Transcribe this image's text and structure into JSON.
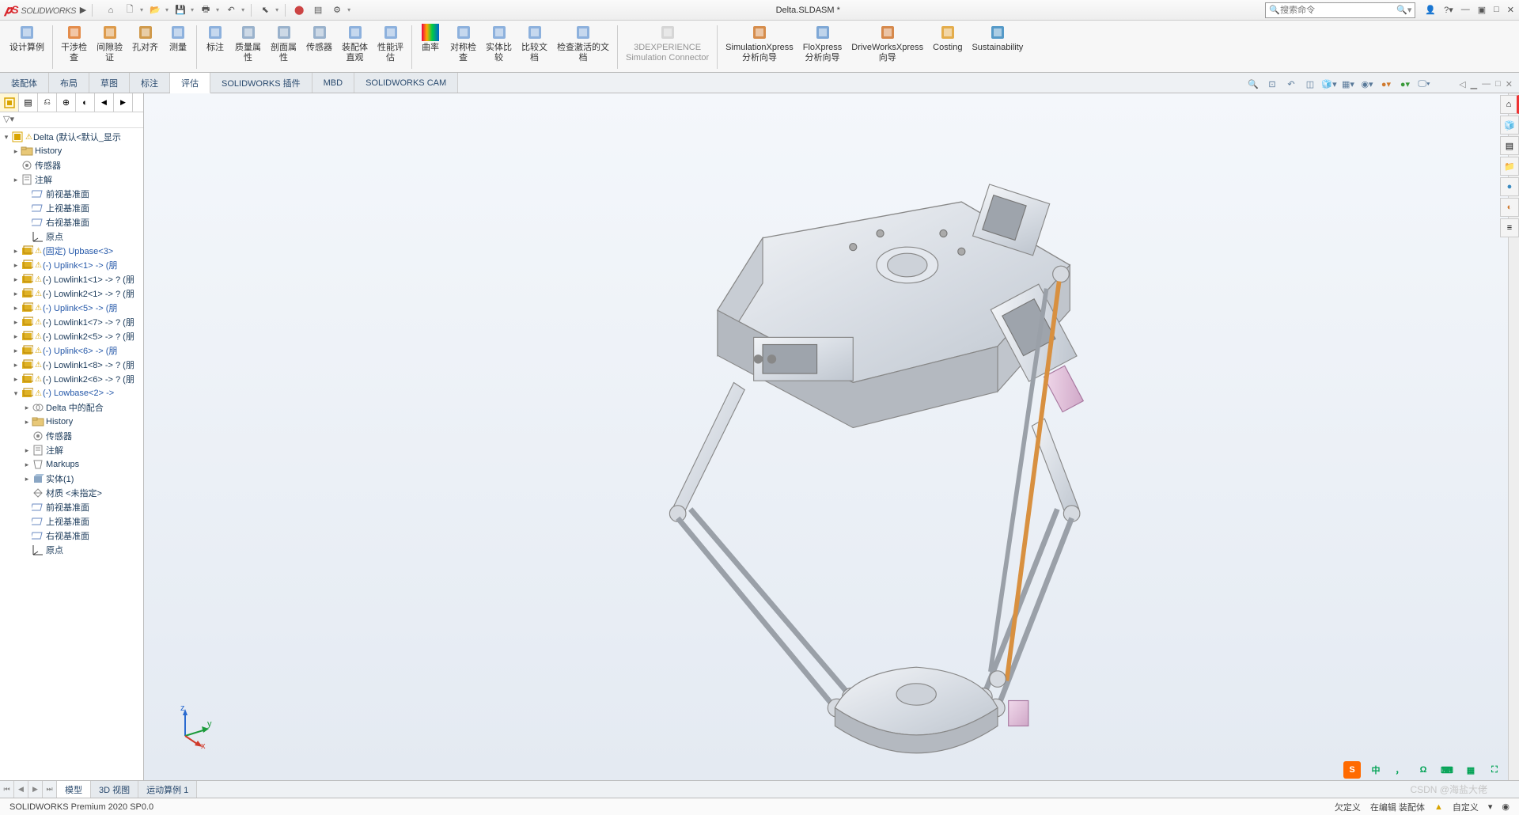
{
  "title": {
    "app": "SOLIDWORKS",
    "document": "Delta.SLDASM *"
  },
  "search": {
    "placeholder": "搜索命令"
  },
  "ribbon": [
    {
      "id": "design-study",
      "label": "设计算例",
      "color": "#7aa4d8"
    },
    {
      "id": "interference",
      "label": "干涉检\n查",
      "color": "#e07a2e"
    },
    {
      "id": "clearance",
      "label": "间隙验\n证",
      "color": "#d88b2e"
    },
    {
      "id": "hole-align",
      "label": "孔对齐",
      "color": "#c98a2e"
    },
    {
      "id": "measure",
      "label": "测量",
      "color": "#7aa4d8"
    },
    {
      "id": "markup",
      "label": "标注",
      "color": "#7aa4d8"
    },
    {
      "id": "mass-props",
      "label": "质量属\n性",
      "color": "#8aa6c4"
    },
    {
      "id": "section-props",
      "label": "剖面属\n性",
      "color": "#8aa6c4"
    },
    {
      "id": "sensor",
      "label": "传感器",
      "color": "#8aa6c4"
    },
    {
      "id": "assembly-vis",
      "label": "装配体\n直观",
      "color": "#7aa4d8"
    },
    {
      "id": "perf-eval",
      "label": "性能评\n估",
      "color": "#7aa4d8"
    },
    {
      "id": "curvature",
      "label": "曲率",
      "color": "#e06a2e",
      "rainbow": true
    },
    {
      "id": "symmetry",
      "label": "对称检\n查",
      "color": "#7aa4d8"
    },
    {
      "id": "compare-bodies",
      "label": "实体比\n较",
      "color": "#7aa4d8"
    },
    {
      "id": "compare-docs",
      "label": "比较文\n档",
      "color": "#7aa4d8"
    },
    {
      "id": "check-active",
      "label": "检查激活的文\n档",
      "color": "#7aa4d8"
    },
    {
      "id": "3dexp",
      "label": "3DEXPERIENCE\nSimulation Connector",
      "disabled": true,
      "color": "#aaa"
    },
    {
      "id": "simx",
      "label": "SimulationXpress\n分析向导",
      "color": "#d07a2e"
    },
    {
      "id": "flox",
      "label": "FloXpress\n分析向导",
      "color": "#6a9ad0"
    },
    {
      "id": "dwx",
      "label": "DriveWorksXpress\n向导",
      "color": "#d0762e"
    },
    {
      "id": "costing",
      "label": "Costing",
      "color": "#e0a02e"
    },
    {
      "id": "sustain",
      "label": "Sustainability",
      "color": "#3a8ac0"
    }
  ],
  "ribbonSeparators": [
    1,
    5,
    11,
    16,
    17
  ],
  "cmdtabs": [
    {
      "id": "assembly",
      "label": "装配体"
    },
    {
      "id": "layout",
      "label": "布局"
    },
    {
      "id": "sketch",
      "label": "草图"
    },
    {
      "id": "annotate",
      "label": "标注"
    },
    {
      "id": "evaluate",
      "label": "评估",
      "active": true
    },
    {
      "id": "addins",
      "label": "SOLIDWORKS 插件"
    },
    {
      "id": "mbd",
      "label": "MBD"
    },
    {
      "id": "cam",
      "label": "SOLIDWORKS CAM"
    }
  ],
  "tree": {
    "root": "Delta  (默认<默认_显示",
    "items": [
      {
        "lvl": 1,
        "exp": "▸",
        "ico": "folder",
        "label": "History"
      },
      {
        "lvl": 1,
        "ico": "sensor",
        "label": "传感器"
      },
      {
        "lvl": 1,
        "exp": "▸",
        "ico": "note",
        "label": "注解"
      },
      {
        "lvl": 2,
        "ico": "plane",
        "label": "前视基准面"
      },
      {
        "lvl": 2,
        "ico": "plane",
        "label": "上视基准面"
      },
      {
        "lvl": 2,
        "ico": "plane",
        "label": "右视基准面"
      },
      {
        "lvl": 2,
        "ico": "origin",
        "label": "原点"
      },
      {
        "lvl": 1,
        "exp": "▸",
        "warn": true,
        "ico": "part",
        "label": "(固定) Upbase<3>",
        "blue": true
      },
      {
        "lvl": 1,
        "exp": "▸",
        "warn": true,
        "ico": "part",
        "label": "(-) Uplink<1> -> (朋",
        "blue": true
      },
      {
        "lvl": 1,
        "exp": "▸",
        "warn": true,
        "ico": "part",
        "label": "(-) Lowlink1<1> -> ? (朋"
      },
      {
        "lvl": 1,
        "exp": "▸",
        "warn": true,
        "ico": "part",
        "label": "(-) Lowlink2<1> -> ? (朋"
      },
      {
        "lvl": 1,
        "exp": "▸",
        "warn": true,
        "ico": "part",
        "label": "(-) Uplink<5> -> (朋",
        "blue": true
      },
      {
        "lvl": 1,
        "exp": "▸",
        "warn": true,
        "ico": "part",
        "label": "(-) Lowlink1<7> -> ? (朋"
      },
      {
        "lvl": 1,
        "exp": "▸",
        "warn": true,
        "ico": "part",
        "label": "(-) Lowlink2<5> -> ? (朋"
      },
      {
        "lvl": 1,
        "exp": "▸",
        "warn": true,
        "ico": "part",
        "label": "(-) Uplink<6> -> (朋",
        "blue": true
      },
      {
        "lvl": 1,
        "exp": "▸",
        "warn": true,
        "ico": "part",
        "label": "(-) Lowlink1<8> -> ? (朋"
      },
      {
        "lvl": 1,
        "exp": "▸",
        "warn": true,
        "ico": "part",
        "label": "(-) Lowlink2<6> -> ? (朋"
      },
      {
        "lvl": 1,
        "exp": "▾",
        "warn": true,
        "ico": "part",
        "label": "(-) Lowbase<2> ->",
        "blue": true
      },
      {
        "lvl": 2,
        "exp": "▸",
        "ico": "mates",
        "label": "Delta 中的配合"
      },
      {
        "lvl": 2,
        "exp": "▸",
        "ico": "folder",
        "label": "History"
      },
      {
        "lvl": 2,
        "ico": "sensor",
        "label": "传感器"
      },
      {
        "lvl": 2,
        "exp": "▸",
        "ico": "note",
        "label": "注解"
      },
      {
        "lvl": 2,
        "exp": "▸",
        "ico": "markup",
        "label": "Markups"
      },
      {
        "lvl": 2,
        "exp": "▸",
        "ico": "solid",
        "label": "实体(1)"
      },
      {
        "lvl": 2,
        "ico": "material",
        "label": "材质 <未指定>"
      },
      {
        "lvl": 2,
        "ico": "plane",
        "label": "前视基准面"
      },
      {
        "lvl": 2,
        "ico": "plane",
        "label": "上视基准面"
      },
      {
        "lvl": 2,
        "ico": "plane",
        "label": "右视基准面"
      },
      {
        "lvl": 2,
        "ico": "origin",
        "label": "原点"
      }
    ]
  },
  "bottomTabs": [
    {
      "id": "model",
      "label": "模型",
      "active": true
    },
    {
      "id": "3dview",
      "label": "3D 视图"
    },
    {
      "id": "motion",
      "label": "运动算例 1"
    }
  ],
  "status": {
    "product": "SOLIDWORKS Premium 2020 SP0.0",
    "underdefined": "欠定义",
    "editing": "在编辑 装配体",
    "custom": "自定义"
  },
  "watermark": "CSDN @海盐大佬",
  "ime": {
    "s": "S",
    "zhong": "中",
    "comma": "，",
    "omega": "Ω"
  },
  "triad": {
    "x": "x",
    "y": "y",
    "z": "z"
  }
}
